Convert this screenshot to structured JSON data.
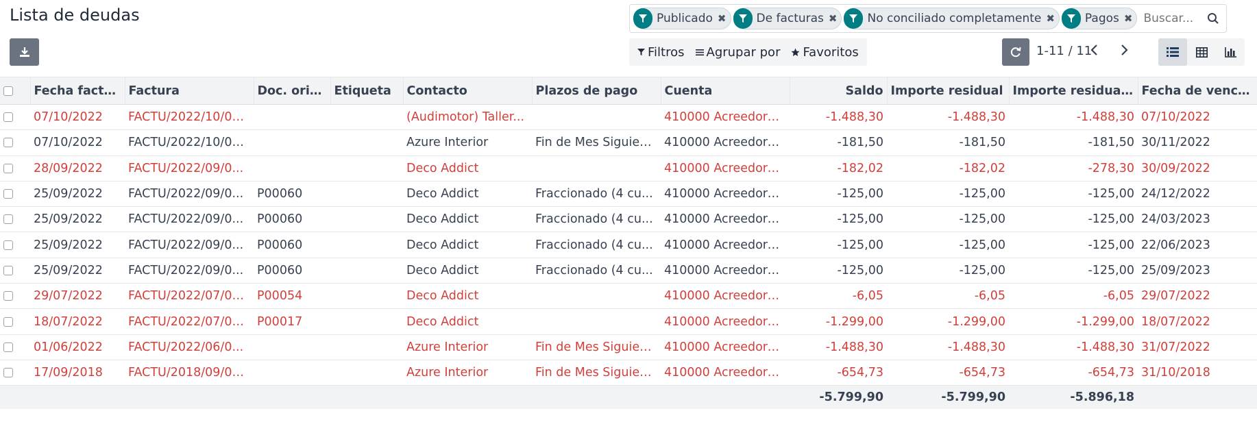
{
  "header": {
    "title": "Lista de deudas"
  },
  "search": {
    "facets": [
      "Publicado",
      "De facturas",
      "No conciliado completamente",
      "Pagos"
    ],
    "placeholder": "Buscar..."
  },
  "toolbar": {
    "filters_label": "Filtros",
    "group_by_label": "Agrupar por",
    "favorites_label": "Favoritos",
    "pager_text": "1-11 / 11"
  },
  "colors": {
    "accent": "#017e84",
    "overdue_text": "#d23f3a"
  },
  "table": {
    "columns": [
      "Fecha factura",
      "Factura",
      "Doc. orig...",
      "Etiqueta",
      "Contacto",
      "Plazos de pago",
      "Cuenta",
      "Saldo",
      "Importe residual",
      "Importe residual ...",
      "Fecha de venci..."
    ],
    "rows": [
      {
        "red": true,
        "cells": [
          "07/10/2022",
          "FACTU/2022/10/00...",
          "",
          "",
          "(Audimotor) Taller...",
          "",
          "410000 Acreedore...",
          "-1.488,30",
          "-1.488,30",
          "-1.488,30",
          "07/10/2022"
        ]
      },
      {
        "red": false,
        "cells": [
          "07/10/2022",
          "FACTU/2022/10/00...",
          "",
          "",
          "Azure Interior",
          "Fin de Mes Siguien...",
          "410000 Acreedore...",
          "-181,50",
          "-181,50",
          "-181,50",
          "30/11/2022"
        ]
      },
      {
        "red": true,
        "cells": [
          "28/09/2022",
          "FACTU/2022/09/0...",
          "",
          "",
          "Deco Addict",
          "",
          "410000 Acreedore...",
          "-182,02",
          "-182,02",
          "-278,30",
          "30/09/2022"
        ]
      },
      {
        "red": false,
        "cells": [
          "25/09/2022",
          "FACTU/2022/09/0...",
          "P00060",
          "",
          "Deco Addict",
          "Fraccionado (4 cu...",
          "410000 Acreedore...",
          "-125,00",
          "-125,00",
          "-125,00",
          "24/12/2022"
        ]
      },
      {
        "red": false,
        "cells": [
          "25/09/2022",
          "FACTU/2022/09/0...",
          "P00060",
          "",
          "Deco Addict",
          "Fraccionado (4 cu...",
          "410000 Acreedore...",
          "-125,00",
          "-125,00",
          "-125,00",
          "24/03/2023"
        ]
      },
      {
        "red": false,
        "cells": [
          "25/09/2022",
          "FACTU/2022/09/0...",
          "P00060",
          "",
          "Deco Addict",
          "Fraccionado (4 cu...",
          "410000 Acreedore...",
          "-125,00",
          "-125,00",
          "-125,00",
          "22/06/2023"
        ]
      },
      {
        "red": false,
        "cells": [
          "25/09/2022",
          "FACTU/2022/09/0...",
          "P00060",
          "",
          "Deco Addict",
          "Fraccionado (4 cu...",
          "410000 Acreedore...",
          "-125,00",
          "-125,00",
          "-125,00",
          "25/09/2023"
        ]
      },
      {
        "red": true,
        "cells": [
          "29/07/2022",
          "FACTU/2022/07/00...",
          "P00054",
          "",
          "Deco Addict",
          "",
          "410000 Acreedore...",
          "-6,05",
          "-6,05",
          "-6,05",
          "29/07/2022"
        ]
      },
      {
        "red": true,
        "cells": [
          "18/07/2022",
          "FACTU/2022/07/00...",
          "P00017",
          "",
          "Deco Addict",
          "",
          "410000 Acreedore...",
          "-1.299,00",
          "-1.299,00",
          "-1.299,00",
          "18/07/2022"
        ]
      },
      {
        "red": true,
        "cells": [
          "01/06/2022",
          "FACTU/2022/06/0...",
          "",
          "",
          "Azure Interior",
          "Fin de Mes Siguien...",
          "410000 Acreedore...",
          "-1.488,30",
          "-1.488,30",
          "-1.488,30",
          "31/07/2022"
        ]
      },
      {
        "red": true,
        "cells": [
          "17/09/2018",
          "FACTU/2018/09/00...",
          "",
          "",
          "Azure Interior",
          "Fin de Mes Siguien...",
          "410000 Acreedore...",
          "-654,73",
          "-654,73",
          "-654,73",
          "31/10/2018"
        ]
      }
    ],
    "totals": {
      "saldo": "-5.799,90",
      "importe_residual": "-5.799,90",
      "importe_residual_currency": "-5.896,18"
    }
  }
}
